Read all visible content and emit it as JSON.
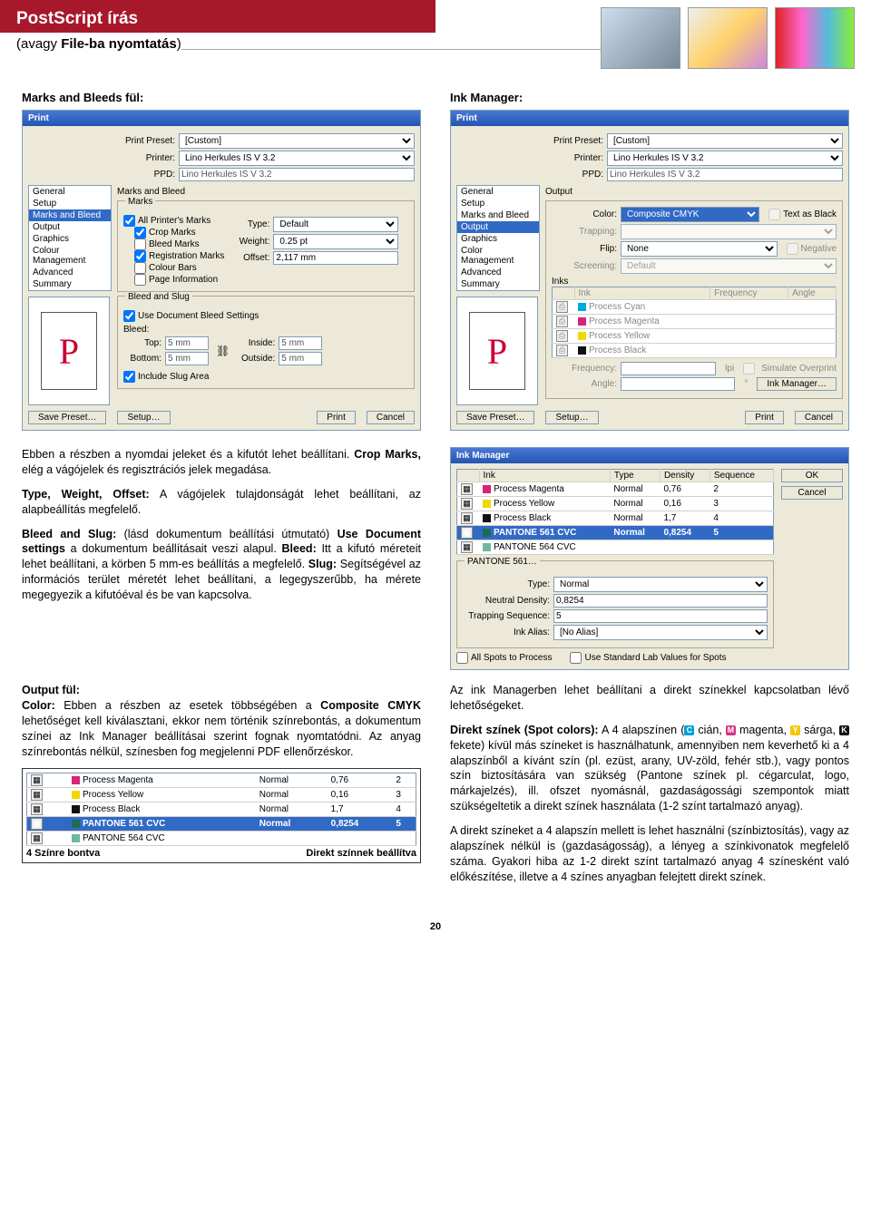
{
  "header": {
    "title": "PostScript írás",
    "subtitle_pre": "(avagy ",
    "subtitle_bold": "File-ba nyomtatás",
    "subtitle_post": ")"
  },
  "section_headings": {
    "marks_bleeds": "Marks and Bleeds fül:",
    "ink_manager": "Ink Manager:"
  },
  "print_dialog_marks": {
    "title": "Print",
    "preset_label": "Print Preset:",
    "preset_value": "[Custom]",
    "printer_label": "Printer:",
    "printer_value": "Lino Herkules IS V 3.2",
    "ppd_label": "PPD:",
    "ppd_value": "Lino Herkules IS V 3.2",
    "sidebar": [
      "General",
      "Setup",
      "Marks and Bleed",
      "Output",
      "Graphics",
      "Colour Management",
      "Advanced",
      "Summary"
    ],
    "sidebar_selected": 2,
    "panel_heading": "Marks and Bleed",
    "marks_group": "Marks",
    "chk_all": "All Printer's Marks",
    "chk_crop": "Crop Marks",
    "chk_bleed": "Bleed Marks",
    "chk_reg": "Registration Marks",
    "chk_bars": "Colour Bars",
    "chk_page": "Page Information",
    "type_label": "Type:",
    "type_value": "Default",
    "weight_label": "Weight:",
    "weight_value": "0.25 pt",
    "offset_label": "Offset:",
    "offset_value": "2,117 mm",
    "bleed_group": "Bleed and Slug",
    "use_doc_bleed": "Use Document Bleed Settings",
    "bleed_label": "Bleed:",
    "top_label": "Top:",
    "bottom_label": "Bottom:",
    "inside_label": "Inside:",
    "outside_label": "Outside:",
    "bleed_val": "5 mm",
    "include_slug": "Include Slug Area",
    "save_preset": "Save Preset…",
    "setup": "Setup…",
    "print": "Print",
    "cancel": "Cancel",
    "preview_letter": "P"
  },
  "print_dialog_output": {
    "title": "Print",
    "sidebar": [
      "General",
      "Setup",
      "Marks and Bleed",
      "Output",
      "Graphics",
      "Color Management",
      "Advanced",
      "Summary"
    ],
    "sidebar_selected": 3,
    "panel_heading": "Output",
    "color_label": "Color:",
    "color_value": "Composite CMYK",
    "text_as_black": "Text as Black",
    "trapping_label": "Trapping:",
    "flip_label": "Flip:",
    "flip_value": "None",
    "negative": "Negative",
    "screening_label": "Screening:",
    "screening_value": "Default",
    "inks_label": "Inks",
    "ink_col": "Ink",
    "freq_col": "Frequency",
    "angle_col": "Angle",
    "ink_rows": [
      "Process Cyan",
      "Process Magenta",
      "Process Yellow",
      "Process Black"
    ],
    "frequency_label": "Frequency:",
    "lpi": "lpi",
    "angle_label": "Angle:",
    "simulate": "Simulate Overprint",
    "ink_mgr_btn": "Ink Manager…",
    "save_preset": "Save Preset…",
    "setup": "Setup…",
    "print": "Print",
    "cancel": "Cancel",
    "preview_letter": "P"
  },
  "body_paragraphs": {
    "p1": "Ebben a részben a nyomdai jeleket és a kifutót lehet beállítani. ",
    "p1b": "Crop Marks,",
    "p1c": " elég a vágójelek és regisztrációs jelek megadása.",
    "p2a": "Type, Weight, Offset:",
    "p2b": " A vágójelek tulajdonságát lehet beállítani, az alapbeállítás megfelelő.",
    "p3a": "Bleed and Slug:",
    "p3b": " (lásd dokumentum beállítási útmutató) ",
    "p3c": "Use Document settings",
    "p3d": " a dokumentum beállításait veszi alapul. ",
    "p3e": "Bleed:",
    "p3f": " Itt a kifutó méreteit lehet beállítani, a körben 5 mm-es beállítás a megfelelő. ",
    "p3g": "Slug:",
    "p3h": " Segítségével az információs terület méretét lehet beállítani, a legegyszerűbb, ha mérete megegyezik a kifutóéval és be van kapcsolva.",
    "p4a": "Output fül:",
    "p4b": "Color:",
    "p4c": " Ebben a részben az esetek többségében a ",
    "p4d": "Composite CMYK",
    "p4e": " lehetőséget kell kiválasztani, ekkor nem történik színrebontás, a dokumentum színei az Ink Manager beállításai szerint fognak nyomtatódni. Az anyag színrebontás nélkül, színesben fog megjelenni PDF ellenőrzéskor.",
    "p5": "Az ink Managerben lehet beállítani a direkt színekkel kapcsolatban lévő lehetőségeket.",
    "p6a": "Direkt színek (Spot colors):",
    "p6b": " A 4 alapszínen (",
    "p6c": " cián, ",
    "p6d": " magenta, ",
    "p6e": " sárga, ",
    "p6f": " fekete) kívül más színeket is használhatunk, amennyiben nem keverhető ki a 4 alapszínből a kívánt szín (pl. ezüst, arany, UV-zöld, fehér stb.), vagy pontos szín biztosítására van szükség (Pantone színek pl. cégarculat, logo, márkajelzés), ill. ofszet nyomásnál, gazdaságossági szempontok miatt szükségeltetik a direkt színek használata (1-2 színt tartalmazó anyag).",
    "p7": "A direkt színeket a 4 alapszín mellett is lehet használni (színbiztosítás), vagy az alapszínek nélkül is (gazdaságosság), a lényeg a színkivonatok megfelelő száma. Gyakori hiba az 1-2 direkt színt tartalmazó anyag 4 színesként való előkészítése, illetve a 4 színes anyagban felejtett direkt színek."
  },
  "ink_manager": {
    "title": "Ink Manager",
    "cols": [
      "Ink",
      "Type",
      "Density",
      "Sequence"
    ],
    "rows": [
      {
        "name": "Process Magenta",
        "type": "Normal",
        "density": "0,76",
        "seq": "2",
        "color": "#d6247b"
      },
      {
        "name": "Process Yellow",
        "type": "Normal",
        "density": "0,16",
        "seq": "3",
        "color": "#f2d800"
      },
      {
        "name": "Process Black",
        "type": "Normal",
        "density": "1,7",
        "seq": "4",
        "color": "#111"
      },
      {
        "name": "PANTONE 561 CVC",
        "type": "Normal",
        "density": "0,8254",
        "seq": "5",
        "color": "#1f6b56",
        "sel": true
      },
      {
        "name": "PANTONE 564 CVC",
        "type": "",
        "density": "",
        "seq": "",
        "color": "#6fb79e"
      }
    ],
    "detail_header": "PANTONE 561…",
    "type_label": "Type:",
    "type_value": "Normal",
    "nd_label": "Neutral Density:",
    "nd_value": "0,8254",
    "ts_label": "Trapping Sequence:",
    "ts_value": "5",
    "alias_label": "Ink Alias:",
    "alias_value": "[No Alias]",
    "all_spots": "All Spots to Process",
    "use_lab": "Use Standard Lab Values for Spots",
    "ok": "OK",
    "cancel": "Cancel"
  },
  "annot_table": {
    "rows": [
      {
        "name": "Process Magenta",
        "type": "Normal",
        "density": "0,76",
        "seq": "2",
        "color": "#d6247b"
      },
      {
        "name": "Process Yellow",
        "type": "Normal",
        "density": "0,16",
        "seq": "3",
        "color": "#f2d800"
      },
      {
        "name": "Process Black",
        "type": "Normal",
        "density": "1,7",
        "seq": "4",
        "color": "#111"
      },
      {
        "name": "PANTONE 561 CVC",
        "type": "Normal",
        "density": "0,8254",
        "seq": "5",
        "color": "#1f6b56",
        "sel": true
      },
      {
        "name": "PANTONE 564 CVC",
        "type": "",
        "density": "",
        "seq": "",
        "color": "#6fb79e"
      }
    ],
    "label_left": "4 Színre bontva",
    "label_right": "Direkt színnek beállítva"
  },
  "spot_letters": {
    "c": "C",
    "m": "M",
    "y": "Y",
    "k": "K"
  },
  "page_number": "20"
}
